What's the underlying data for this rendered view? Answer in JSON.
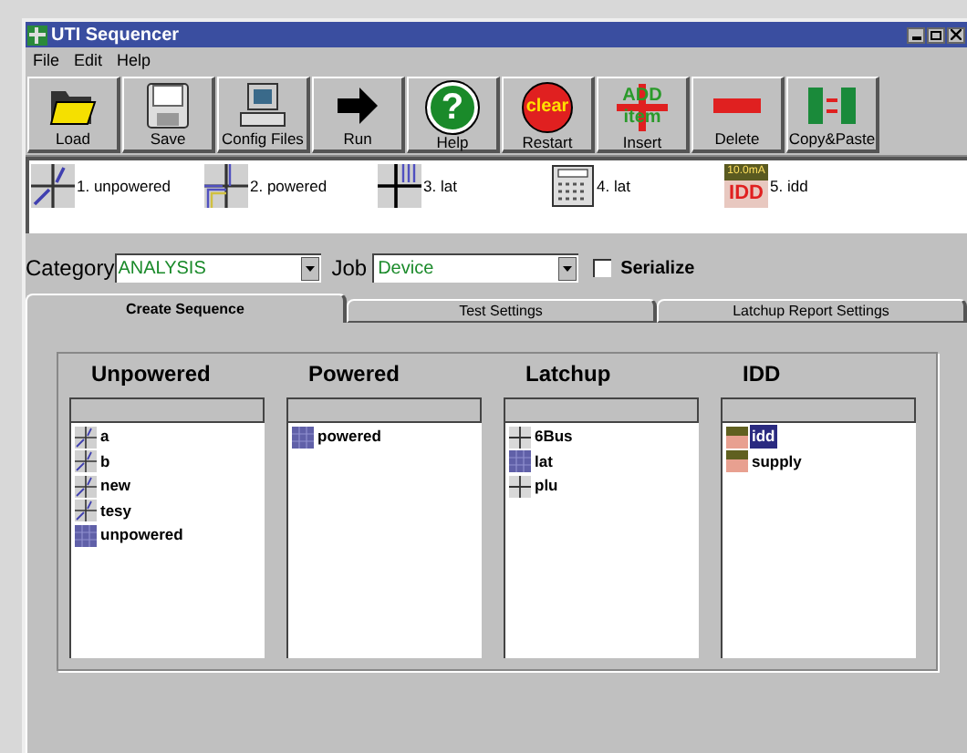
{
  "window": {
    "title": "UTI Sequencer"
  },
  "menu": [
    "File",
    "Edit",
    "Help"
  ],
  "toolbar": [
    {
      "label": "Load",
      "kind": "folder"
    },
    {
      "label": "Save",
      "kind": "disk"
    },
    {
      "label": "Config Files",
      "kind": "computer"
    },
    {
      "label": "Run",
      "kind": "arrow"
    },
    {
      "label": "Help",
      "kind": "help",
      "glyph": "?"
    },
    {
      "label": "Restart",
      "kind": "clear",
      "glyph": "clear"
    },
    {
      "label": "Insert",
      "kind": "add",
      "glyph": "ADD",
      "glyph2": "item"
    },
    {
      "label": "Delete",
      "kind": "minus"
    },
    {
      "label": "Copy&Paste",
      "kind": "copy"
    }
  ],
  "sequence": [
    {
      "label": "1. unpowered",
      "kind": "curve"
    },
    {
      "label": "2. powered",
      "kind": "powered"
    },
    {
      "label": "3. lat",
      "kind": "lat"
    },
    {
      "label": "4. lat",
      "kind": "calc"
    },
    {
      "label": "5. idd",
      "kind": "idd",
      "glyph": "IDD",
      "glyph2": "10.0mA"
    }
  ],
  "category": {
    "label": "Category",
    "value": "ANALYSIS"
  },
  "job": {
    "label": "Job",
    "value": "Device"
  },
  "serialize": {
    "label": "Serialize",
    "checked": false
  },
  "tabs": [
    {
      "label": "Create Sequence",
      "selected": true
    },
    {
      "label": "Test Settings",
      "selected": false
    },
    {
      "label": "Latchup Report Settings",
      "selected": false
    }
  ],
  "lists": [
    {
      "title": "Unpowered",
      "items": [
        {
          "label": "a",
          "kind": "curve",
          "selected": false
        },
        {
          "label": "b",
          "kind": "curve",
          "selected": false
        },
        {
          "label": "new",
          "kind": "curve",
          "selected": false
        },
        {
          "label": "tesy",
          "kind": "curve",
          "selected": false
        },
        {
          "label": "unpowered",
          "kind": "grid",
          "selected": false
        }
      ]
    },
    {
      "title": "Powered",
      "items": [
        {
          "label": "powered",
          "kind": "grid",
          "selected": false
        }
      ]
    },
    {
      "title": "Latchup",
      "items": [
        {
          "label": "6Bus",
          "kind": "cross",
          "selected": false
        },
        {
          "label": "lat",
          "kind": "grid",
          "selected": false
        },
        {
          "label": "plu",
          "kind": "cross",
          "selected": false
        }
      ]
    },
    {
      "title": "IDD",
      "items": [
        {
          "label": "idd",
          "kind": "idd",
          "selected": true
        },
        {
          "label": "supply",
          "kind": "idd",
          "selected": false
        }
      ]
    }
  ]
}
